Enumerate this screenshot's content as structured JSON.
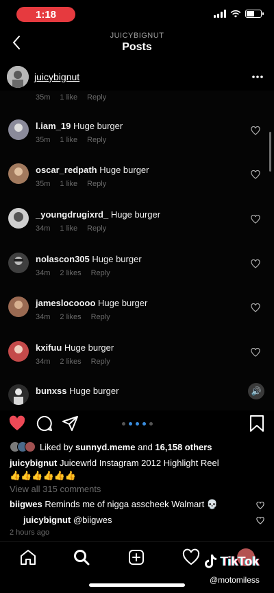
{
  "status_bar": {
    "time": "1:18"
  },
  "nav": {
    "subtitle": "JUICYBIGNUT",
    "title": "Posts"
  },
  "post_owner": {
    "username": "juicybignut"
  },
  "partial_comment": {
    "time": "35m",
    "likes": "1 like",
    "reply": "Reply"
  },
  "comments": [
    {
      "username": "l.iam_19",
      "text": "Huge burger",
      "time": "35m",
      "likes": "1 like",
      "reply": "Reply",
      "avatar_color": "#8a8a9a"
    },
    {
      "username": "oscar_redpath",
      "text": "Huge burger",
      "time": "35m",
      "likes": "1 like",
      "reply": "Reply",
      "avatar_color": "#a27a5e"
    },
    {
      "username": "_youngdrugixrd_",
      "text": "Huge burger",
      "time": "34m",
      "likes": "1 like",
      "reply": "Reply",
      "avatar_color": "#cfcfcf"
    },
    {
      "username": "nolascon305",
      "text": "Huge burger",
      "time": "34m",
      "likes": "2 likes",
      "reply": "Reply",
      "avatar_color": "#3f3f3f"
    },
    {
      "username": "jameslocoooo",
      "text": "Huge burger",
      "time": "34m",
      "likes": "2 likes",
      "reply": "Reply",
      "avatar_color": "#9a6a52"
    },
    {
      "username": "kxifuu",
      "text": "Huge burger",
      "time": "34m",
      "likes": "2 likes",
      "reply": "Reply",
      "avatar_color": "#c44a4a"
    },
    {
      "username": "bunxss",
      "text": "Huge burger",
      "time": "",
      "likes": "",
      "reply": "",
      "avatar_color": "#2c2c2c"
    }
  ],
  "likes": {
    "prefix": "Liked by",
    "first_user": "sunnyd.meme",
    "joiner": "and",
    "count": "16,158 others"
  },
  "caption": {
    "username": "juicybignut",
    "text": "Juicewrld Instagram 2012 Highlight Reel",
    "emoji": "👍👍👍👍👍👍"
  },
  "view_all": "View all 315 comments",
  "preview_comments": [
    {
      "username": "biigwes",
      "text": "Reminds me of nigga asscheek Walmart 💀"
    },
    {
      "username": "juicybignut",
      "text": "@biigwes"
    }
  ],
  "time_ago": "2 hours ago",
  "watermark": {
    "brand": "TikTok",
    "user": "@motomiless"
  },
  "colors": {
    "heart_red": "#ed4956",
    "time_pill": "#e63a3f",
    "carousel_active": "#3a8dde"
  },
  "icons": [
    "back-icon",
    "more-icon",
    "heart-icon",
    "comment-icon",
    "share-icon",
    "bookmark-icon",
    "home-icon",
    "search-icon",
    "add-icon",
    "activity-icon",
    "sound-icon"
  ]
}
